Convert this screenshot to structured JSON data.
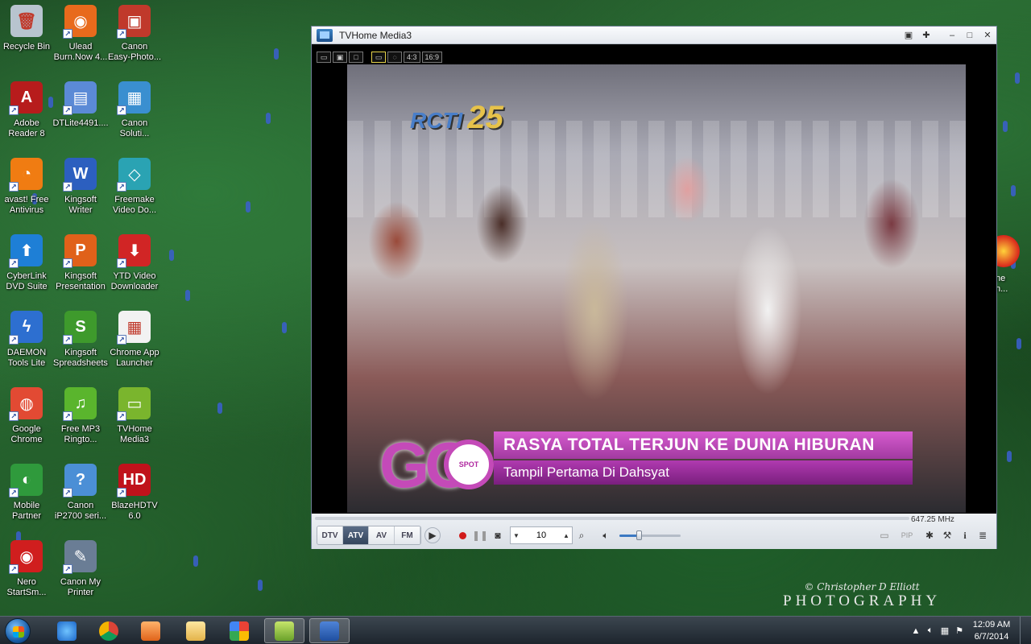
{
  "desktop": {
    "icons": [
      {
        "label": "Recycle Bin",
        "color": "#b8c4cf"
      },
      {
        "label": "Ulead\nBurn.Now 4...",
        "color": "#e86a1c"
      },
      {
        "label": "Canon\nEasy-Photo...",
        "color": "#c0392b"
      },
      {
        "label": "Adobe\nReader 8",
        "color": "#b71c1c"
      },
      {
        "label": "DTLite4491....",
        "color": "#5b8ad6"
      },
      {
        "label": "Canon\nSoluti...",
        "color": "#3a8fd0"
      },
      {
        "label": "avast! Free\nAntivirus",
        "color": "#f07c12"
      },
      {
        "label": "Kingsoft\nWriter",
        "color": "#2c5fbf"
      },
      {
        "label": "Freemake\nVideo Do...",
        "color": "#2aa3b3"
      },
      {
        "label": "CyberLink\nDVD Suite",
        "color": "#1e7fd6"
      },
      {
        "label": "Kingsoft\nPresentation",
        "color": "#e0611a"
      },
      {
        "label": "YTD Video\nDownloader",
        "color": "#d12525"
      },
      {
        "label": "DAEMON\nTools Lite",
        "color": "#2d6fd0"
      },
      {
        "label": "Kingsoft\nSpreadsheets",
        "color": "#3e9a2c"
      },
      {
        "label": "Chrome App\nLauncher",
        "color": "#f2f2f2"
      },
      {
        "label": "Google\nChrome",
        "color": "#e24a33"
      },
      {
        "label": "Free MP3\nRingto...",
        "color": "#5ab52d"
      },
      {
        "label": "TVHome\nMedia3",
        "color": "#7ab52d"
      },
      {
        "label": "Mobile\nPartner",
        "color": "#2f9a3c"
      },
      {
        "label": "Canon\niP2700 seri...",
        "color": "#4b8fd6"
      },
      {
        "label": "BlazeHDTV\n6.0",
        "color": "#c0121b"
      },
      {
        "label": "Nero\nStartSm...",
        "color": "#d01e1e"
      },
      {
        "label": "Canon My\nPrinter",
        "color": "#6a7d95"
      }
    ],
    "partial_icon_label": "ne\nn..."
  },
  "tv_window": {
    "title": "TVHome Media3",
    "aspect_buttons": [
      "▭",
      "▣",
      "□",
      "▭",
      "◌",
      "4:3",
      "16:9"
    ],
    "frequency": "647.25 MHz",
    "modes": [
      "DTV",
      "ATV",
      "AV",
      "FM"
    ],
    "active_mode": "ATV",
    "channel": "10",
    "volume_level": 0.32,
    "pip_label": "PIP",
    "video": {
      "channel_logo": "RCTI",
      "channel_logo_num": "25",
      "segment_logo": "GO",
      "segment_spot": "SPOT",
      "headline": "RASYA TOTAL TERJUN KE DUNIA HIBURAN",
      "subheadline": "Tampil Pertama Di Dahsyat"
    }
  },
  "watermark": {
    "line1": "© Christopher D Elliott",
    "line2": "PHOTOGRAPHY"
  },
  "taskbar": {
    "time": "12:09 AM",
    "date": "6/7/2014"
  }
}
